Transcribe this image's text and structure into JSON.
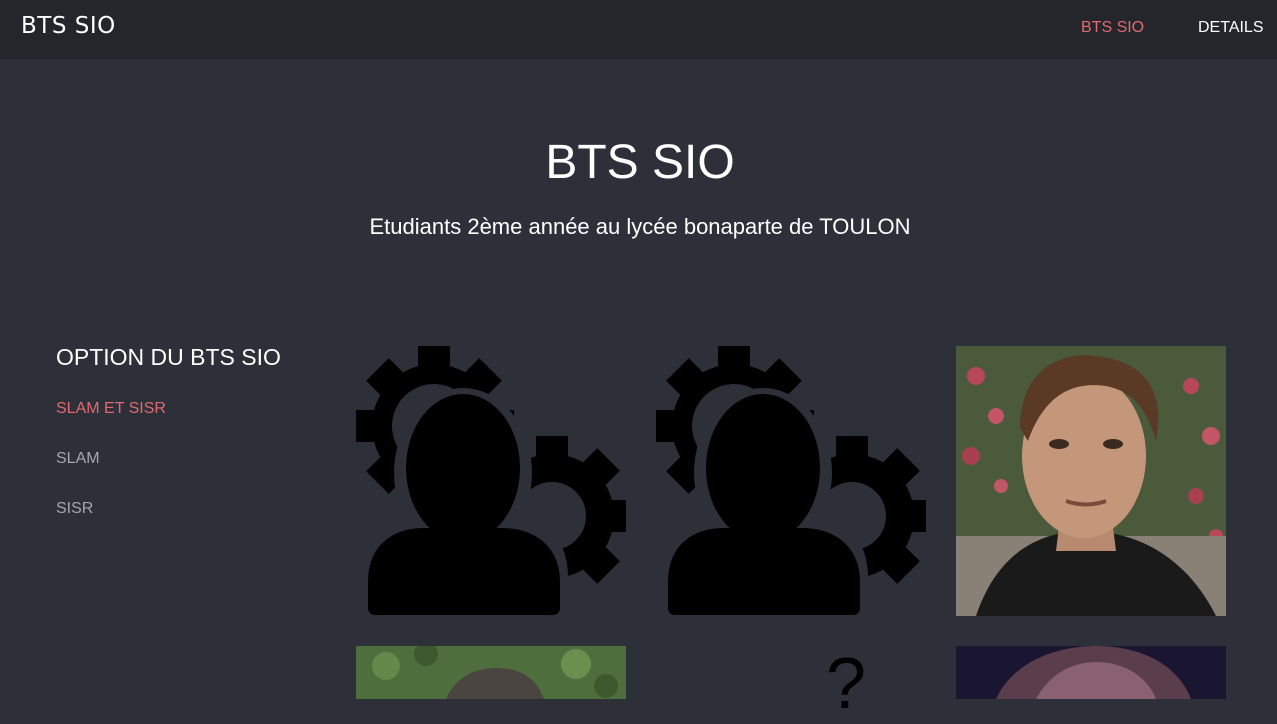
{
  "navbar": {
    "brand": "BTS SIO",
    "links": [
      {
        "label": "BTS SIO",
        "active": true
      },
      {
        "label": "DETAILS",
        "active": false
      }
    ]
  },
  "hero": {
    "title": "BTS SIO",
    "subtitle": "Etudiants 2ème année au lycée bonaparte de TOULON"
  },
  "sidebar": {
    "title": "OPTION DU BTS SIO",
    "items": [
      {
        "label": "SLAM ET SISR",
        "active": true
      },
      {
        "label": "SLAM",
        "active": false
      },
      {
        "label": "SISR",
        "active": false
      }
    ]
  },
  "gallery": {
    "tiles": [
      {
        "kind": "icon",
        "icon": "user-gear-icon"
      },
      {
        "kind": "icon",
        "icon": "user-gear-icon"
      },
      {
        "kind": "photo",
        "subject": "student-portrait"
      },
      {
        "kind": "photo",
        "subject": "student-portrait"
      },
      {
        "kind": "glyph",
        "text": "?"
      },
      {
        "kind": "photo",
        "subject": "student-portrait"
      }
    ]
  },
  "colors": {
    "background": "#2e3039",
    "navbar": "#24262c",
    "accent": "#e36a6f",
    "muted": "#a4a6ad",
    "text": "#ffffff"
  }
}
